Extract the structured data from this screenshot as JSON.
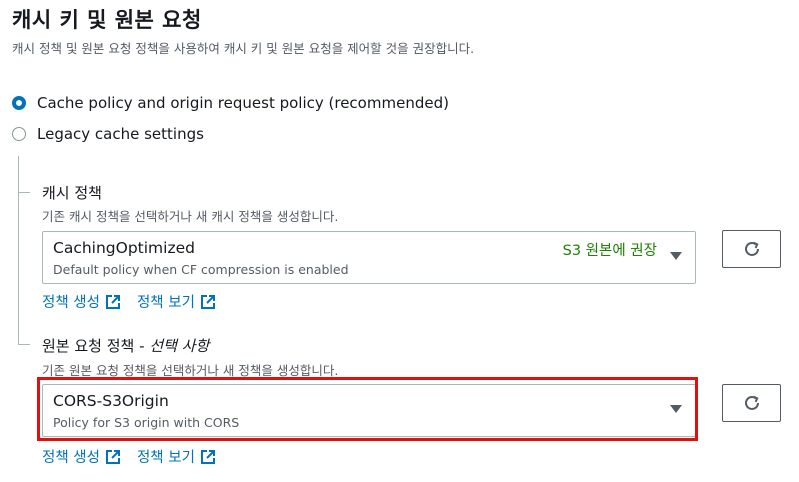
{
  "header": {
    "title": "캐시 키 및 원본 요청",
    "description": "캐시 정책 및 원본 요청 정책을 사용하여 캐시 키 및 원본 요청을 제어할 것을 권장합니다."
  },
  "options": [
    {
      "label": "Cache policy and origin request policy (recommended)",
      "selected": true
    },
    {
      "label": "Legacy cache settings",
      "selected": false
    }
  ],
  "cache_policy": {
    "label": "캐시 정책",
    "description": "기존 캐시 정책을 선택하거나 새 캐시 정책을 생성합니다.",
    "selected_value": "CachingOptimized",
    "selected_desc": "Default policy when CF compression is enabled",
    "tag": "S3 원본에 권장",
    "link_create": "정책 생성",
    "link_view": "정책 보기"
  },
  "origin_policy": {
    "label": "원본 요청 정책 -",
    "label_optional": "선택 사항",
    "description": "기존 원본 요청 정책을 선택하거나 새 정책을 생성합니다.",
    "selected_value": "CORS-S3Origin",
    "selected_desc": "Policy for S3 origin with CORS",
    "link_create": "정책 생성",
    "link_view": "정책 보기"
  },
  "colors": {
    "accent": "#0073bb",
    "success": "#1d8102",
    "highlight": "#e01010"
  },
  "icons": {
    "refresh": "refresh-icon",
    "external": "external-link-icon",
    "caret": "caret-down-icon"
  }
}
